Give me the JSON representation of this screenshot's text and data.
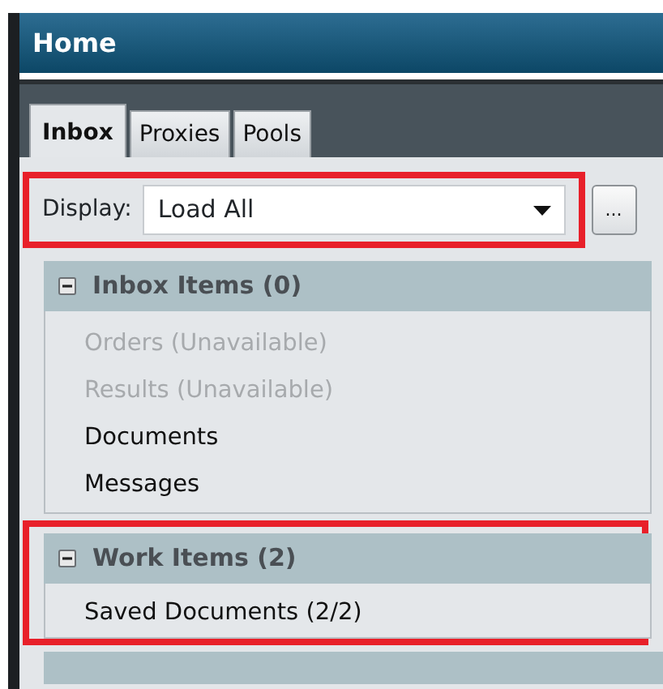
{
  "window": {
    "title": "Home"
  },
  "tabs": [
    {
      "label": "Inbox",
      "selected": true
    },
    {
      "label": "Proxies",
      "selected": false
    },
    {
      "label": "Pools",
      "selected": false
    }
  ],
  "display": {
    "label": "Display:",
    "value": "Load All",
    "highlighted": true
  },
  "more_button": {
    "label": "..."
  },
  "sections": [
    {
      "title": "Inbox Items (0)",
      "expanded": true,
      "highlighted": false,
      "items": [
        {
          "label": "Orders (Unavailable)",
          "disabled": true
        },
        {
          "label": "Results (Unavailable)",
          "disabled": true
        },
        {
          "label": "Documents",
          "disabled": false
        },
        {
          "label": "Messages",
          "disabled": false
        }
      ]
    },
    {
      "title": "Work Items (2)",
      "expanded": true,
      "highlighted": true,
      "items": [
        {
          "label": "Saved Documents (2/2)",
          "disabled": false
        }
      ]
    }
  ]
}
